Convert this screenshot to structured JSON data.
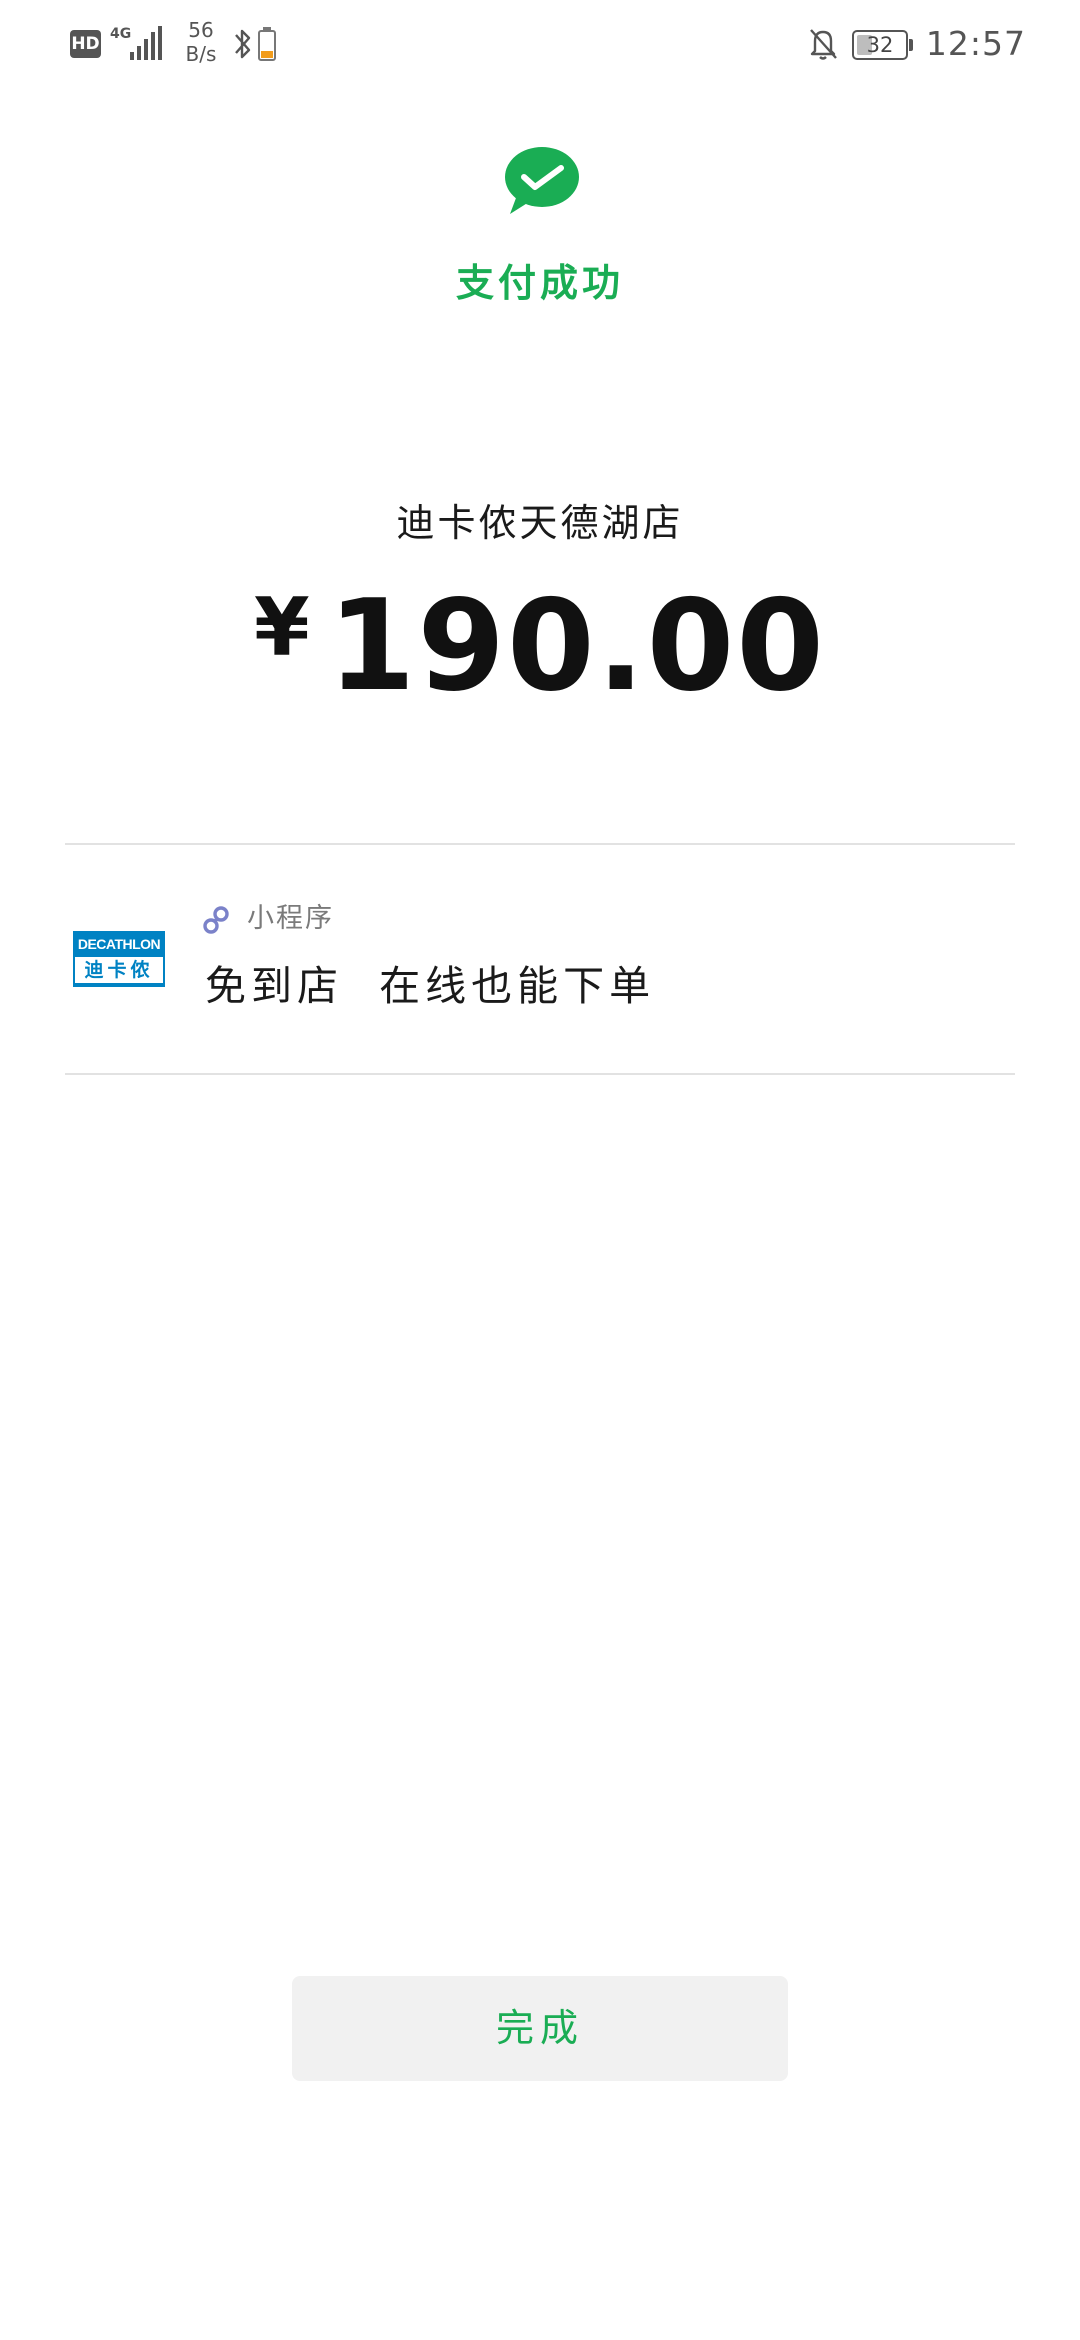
{
  "status_bar": {
    "hd_badge": "HD",
    "network": "4G",
    "speed_value": "56",
    "speed_unit": "B/s",
    "battery_level": "32",
    "time": "12:57"
  },
  "header": {
    "app_icon": "wechat-pay-check-icon",
    "status_text": "支付成功"
  },
  "payment": {
    "merchant": "迪卡侬天德湖店",
    "currency_symbol": "¥",
    "amount": "190.00"
  },
  "mini_program": {
    "logo_brand": "DECATHLON",
    "logo_cn": "迪卡侬",
    "type_label": "小程序",
    "title": "免到店  在线也能下单"
  },
  "actions": {
    "done_label": "完成"
  },
  "colors": {
    "accent_green": "#1aad54",
    "brand_blue": "#0082c3",
    "mini_program_icon": "#7b82c9",
    "button_bg": "#f1f1f1",
    "divider": "#e2e2e2"
  },
  "battery_fraction": 0.32
}
